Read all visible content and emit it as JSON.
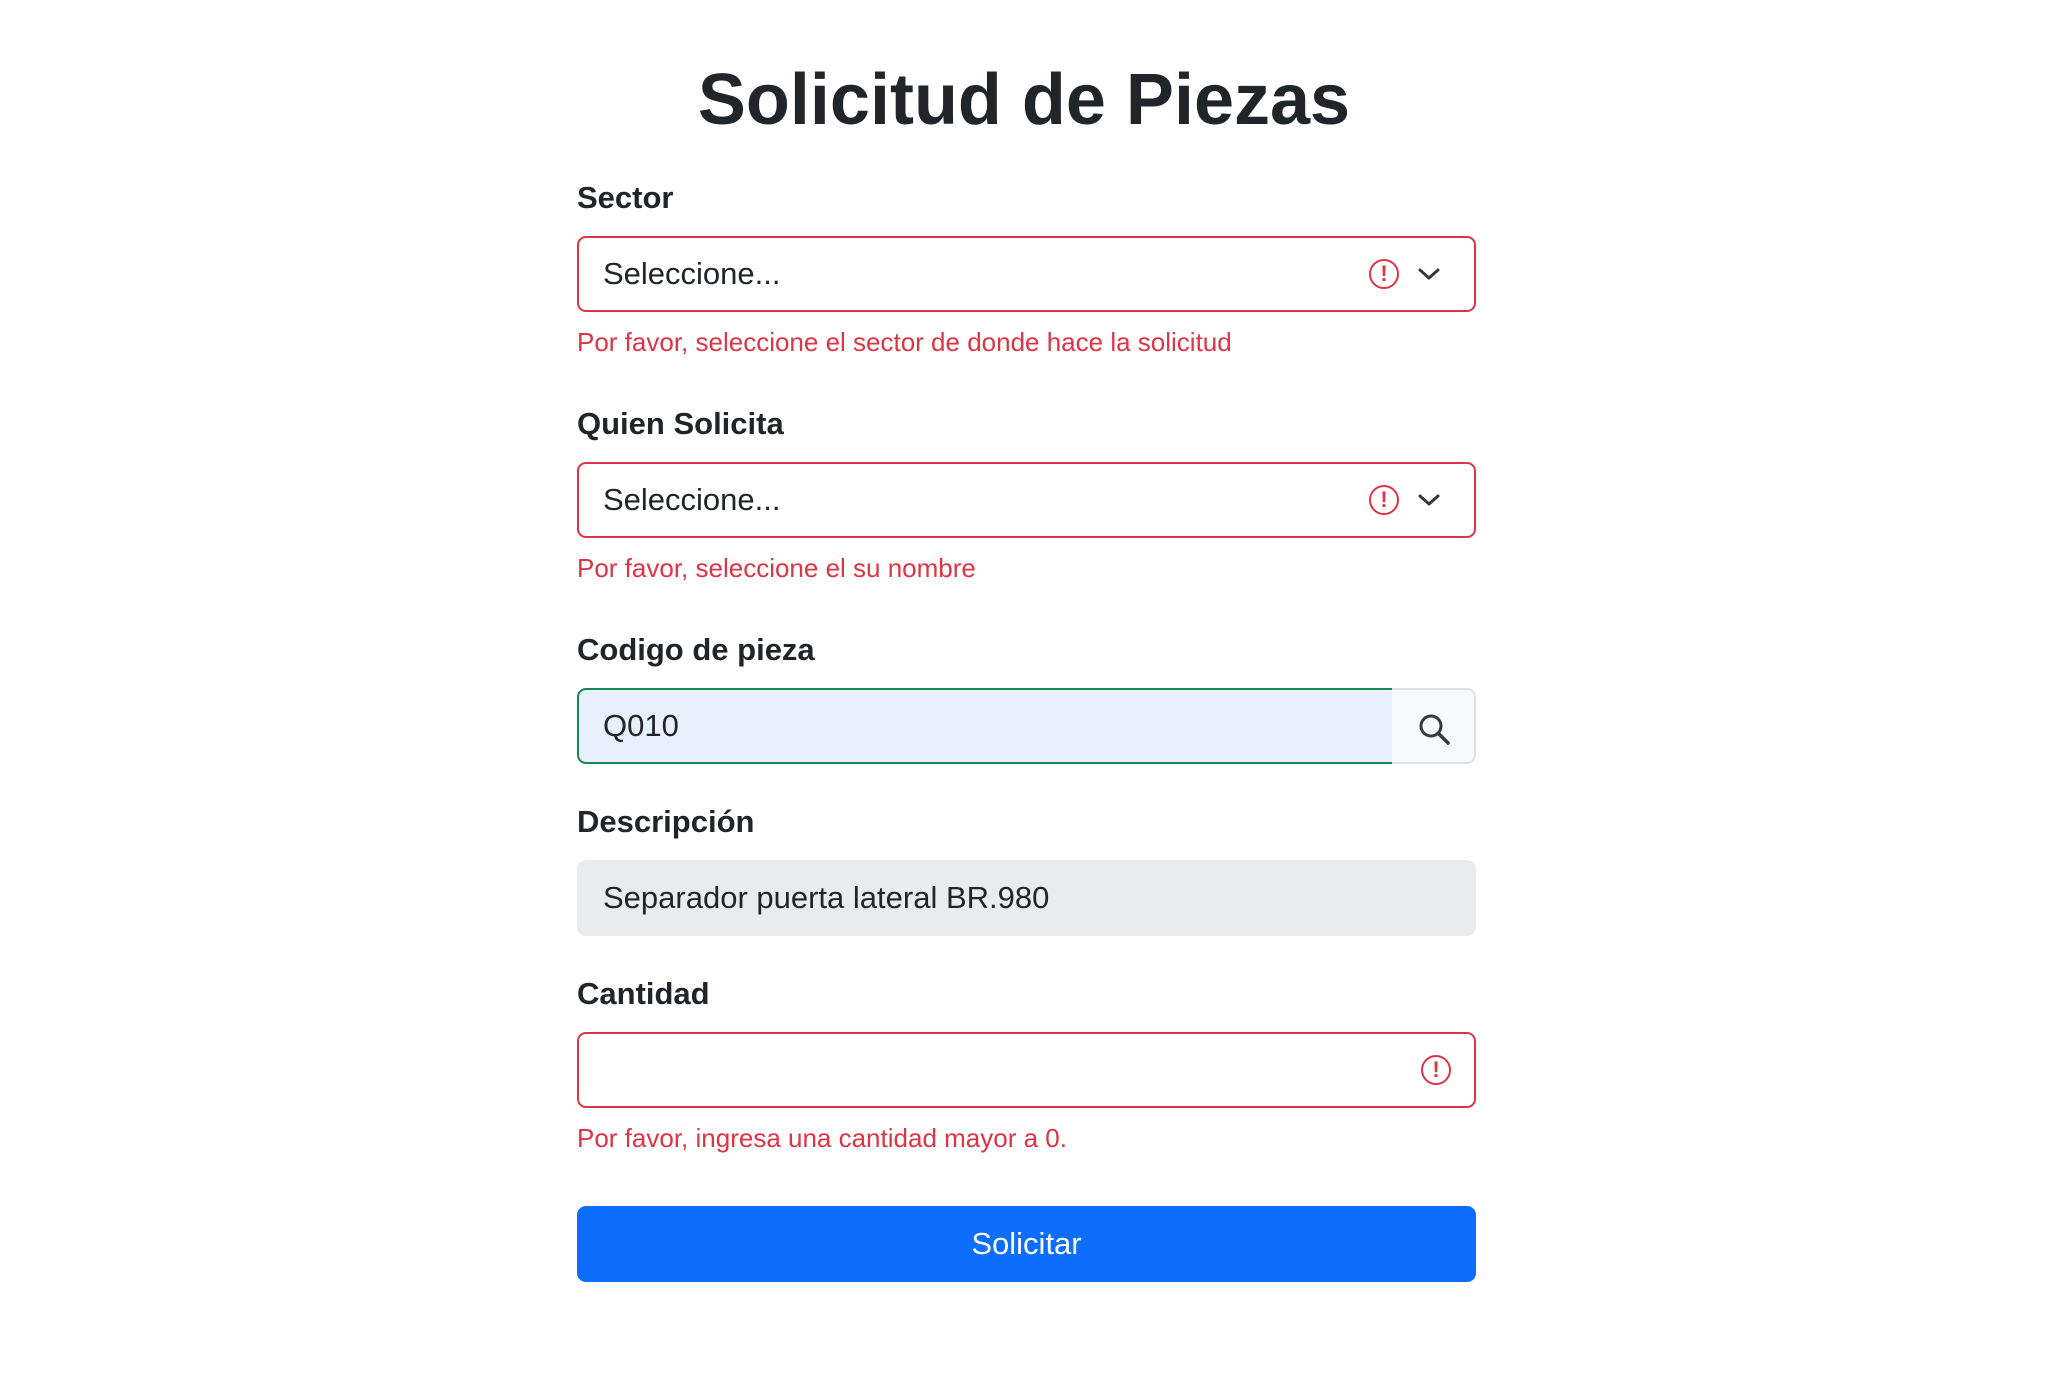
{
  "page": {
    "title": "Solicitud de Piezas"
  },
  "form": {
    "sector": {
      "label": "Sector",
      "selected": "Seleccione...",
      "feedback": "Por favor, seleccione el sector de donde hace la solicitud",
      "state": "invalid"
    },
    "solicitante": {
      "label": "Quien Solicita",
      "selected": "Seleccione...",
      "feedback": "Por favor, seleccione el su nombre",
      "state": "invalid"
    },
    "codigo": {
      "label": "Codigo de pieza",
      "value": "Q010",
      "state": "valid",
      "button_icon": "search-icon"
    },
    "descripcion": {
      "label": "Descripción",
      "value": "Separador puerta lateral BR.980",
      "state": "readonly"
    },
    "cantidad": {
      "label": "Cantidad",
      "value": "",
      "feedback": "Por favor, ingresa una cantidad mayor a 0.",
      "state": "invalid"
    },
    "submit_label": "Solicitar"
  },
  "colors": {
    "primary": "#0d6efd",
    "danger": "#dc3545",
    "success": "#198754",
    "readonly_bg": "#e9ecef",
    "autofill_bg": "#e8f0fe"
  }
}
